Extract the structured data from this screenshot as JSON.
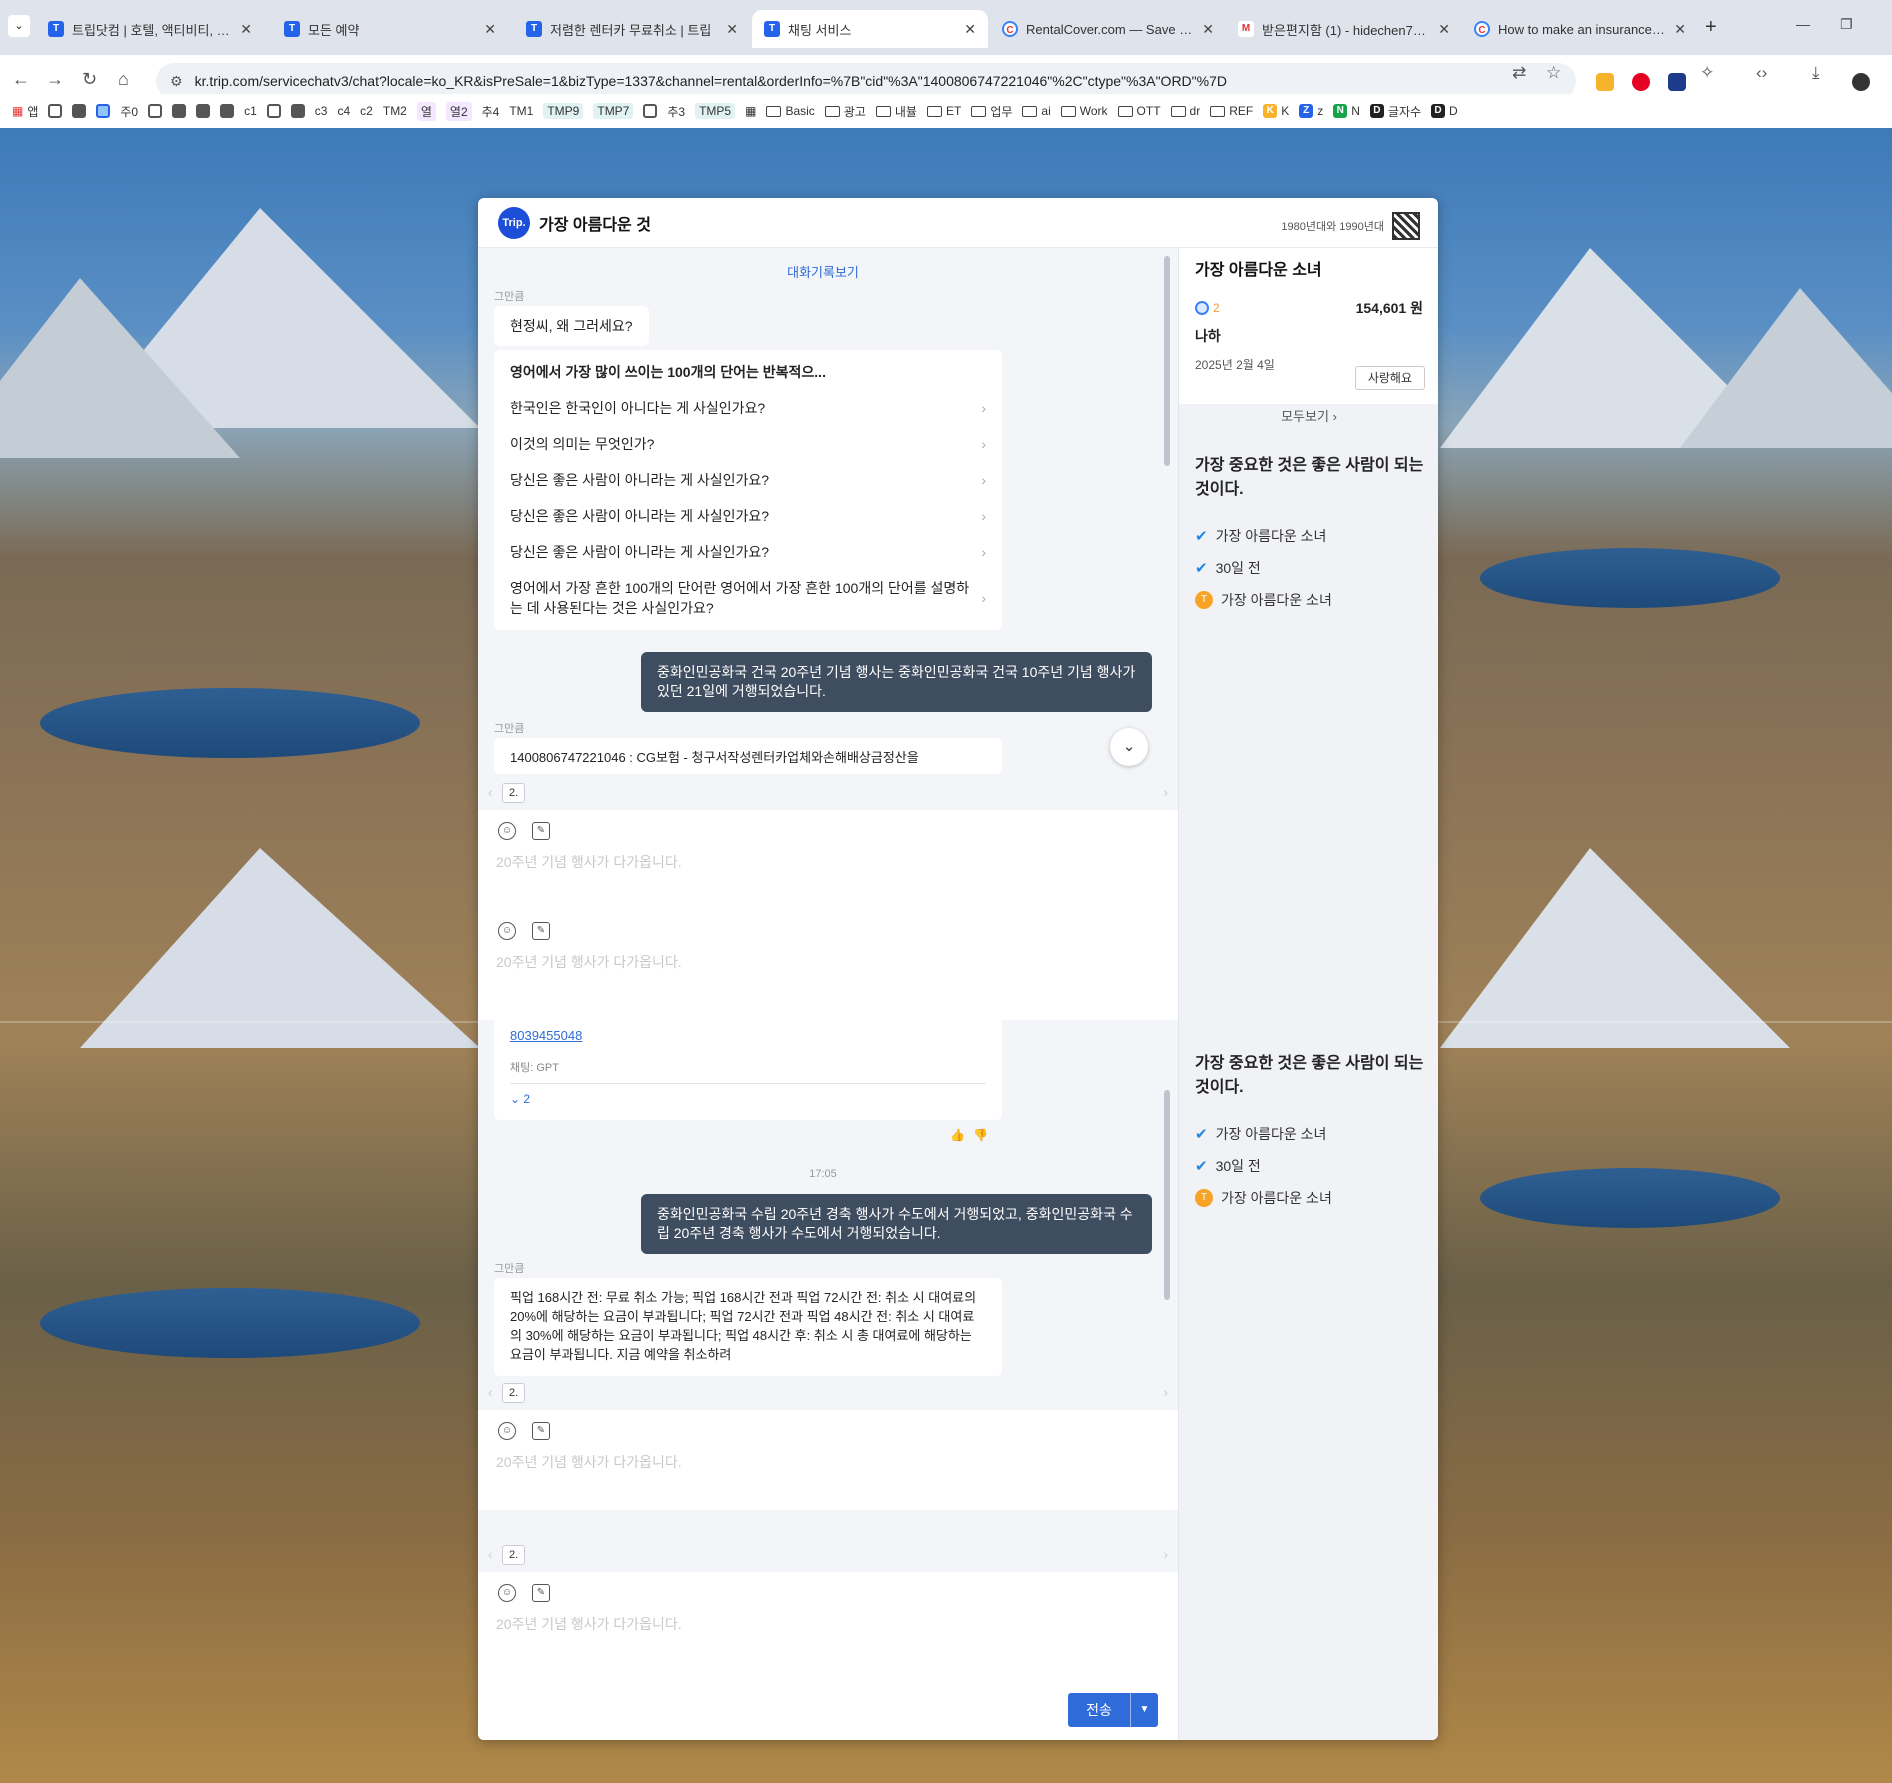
{
  "browser": {
    "tabs": [
      {
        "title": "트립닷컴 | 호텔, 액티비티, 항공",
        "favicon": "T"
      },
      {
        "title": "모든 예약",
        "favicon": "T"
      },
      {
        "title": "저렴한 렌터카 무료취소 | 트립",
        "favicon": "T"
      },
      {
        "title": "채팅 서비스",
        "favicon": "T",
        "active": true
      },
      {
        "title": "RentalCover.com — Save On Y",
        "favicon": "C"
      },
      {
        "title": "받은편지함 (1) - hidechen75@",
        "favicon": "M"
      },
      {
        "title": "How to make an insurance cla",
        "favicon": "C"
      }
    ],
    "url": "kr.trip.com/servicechatv3/chat?locale=ko_KR&isPreSale=1&bizType=1337&channel=rental&orderInfo=%7B\"cid\"%3A\"1400806747221046\"%2C\"ctype\"%3A\"ORD\"%7D",
    "bookmarks": [
      "앱",
      "",
      "",
      "",
      "주0",
      "",
      "",
      "",
      "",
      "c1",
      "",
      "",
      "c3",
      "c4",
      "c2",
      "TM2",
      "열",
      "열2",
      "추4",
      "TM1",
      "TMP9",
      "TMP7",
      "",
      "추3",
      "TMP5",
      "",
      "Basic",
      "광고",
      "내뷸",
      "ET",
      "업무",
      "ai",
      "Work",
      "OTT",
      "dr",
      "REF",
      "K",
      "z",
      "N",
      "글자수",
      "D"
    ]
  },
  "chat_panel": {
    "title": "가장 아름다운 것",
    "logo": "Trip.",
    "header_note": "1980년대와 1990년대",
    "history_link": "대화기록보기",
    "sender_name": "그만큼",
    "greeting": "현정씨, 왜 그러세요?",
    "faq_title": "영어에서 가장 많이 쓰이는 100개의 단어는 반복적으...",
    "faq_items": [
      "한국인은 한국인이 아니다는 게 사실인가요?",
      "이것의 의미는 무엇인가?",
      "당신은 좋은 사람이 아니라는 게 사실인가요?",
      "당신은 좋은 사람이 아니라는 게 사실인가요?",
      "당신은 좋은 사람이 아니라는 게 사실인가요?",
      "영어에서 가장 흔한 100개의 단어란 영어에서 가장 흔한 100개의 단어를 설명하는 데 사용된다는 것은 사실인가요?"
    ],
    "user_msg_1": "중화인민공화국 건국 20주년 기념 행사는 중화인민공화국 건국 10주년 기념 행사가 있던 21일에 거행되었습니다.",
    "bot_msg_1": "1400806747221046 : CG보험 - 청구서작성렌터카업체와손해배상금정산을",
    "count_label": "2.",
    "input_placeholder": "20주년 기념 행사가 다가옵니다.",
    "bot_link": "8039455048",
    "bot_meta": "채팅: GPT",
    "expand_label": "2",
    "time": "17:05",
    "user_msg_2": "중화인민공화국 수립 20주년 경축 행사가 수도에서 거행되었고, 중화인민공화국 수립 20주년 경축 행사가 수도에서 거행되었습니다.",
    "bot_msg_2": "픽업 168시간 전: 무료 취소 가능; 픽업 168시간 전과 픽업 72시간 전: 취소 시 대여료의 20%에 해당하는 요금이 부과됩니다; 픽업 72시간 전과 픽업 48시간 전: 취소 시 대여료의 30%에 해당하는 요금이 부과됩니다; 픽업 48시간 후: 취소 시 총 대여료에 해당하는 요금이 부과됩니다. 지금 예약을 취소하려",
    "send_label": "전송"
  },
  "sidebar": {
    "title": "가장 아름다운 소녀",
    "order_status": "2",
    "order_price": "154,601 원",
    "order_name": "나하",
    "order_date": "2025년 2월 4일",
    "order_button": "사랑해요",
    "view_all": "모두보기",
    "tip_title": "가장 중요한 것은 좋은 사람이 되는 것이다.",
    "tips": [
      "가장 아름다운 소녀",
      "30일 전",
      "가장 아름다운 소녀"
    ]
  },
  "colors": {
    "accent": "#2f6bd9",
    "user_bubble": "#3f4d60",
    "status": "#f29d38"
  }
}
